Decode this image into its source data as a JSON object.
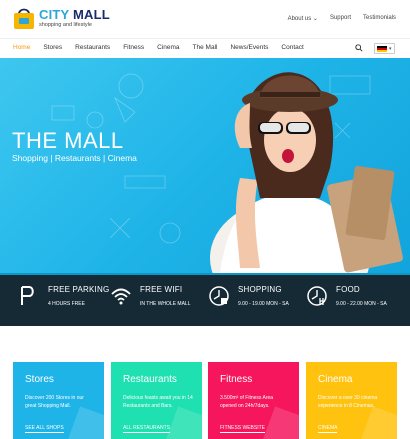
{
  "brand": {
    "title_city": "CITY",
    "title_mall": "MALL",
    "subtitle": "shopping and lifestyle"
  },
  "top_links": [
    "About us",
    "Support",
    "Testimonials"
  ],
  "nav": {
    "items": [
      "Home",
      "Stores",
      "Restaurants",
      "Fitness",
      "Cinema",
      "The Mall",
      "News/Events",
      "Contact"
    ],
    "active": "Home",
    "language": "DE"
  },
  "hero": {
    "title": "THE MALL",
    "subtitle": "Shopping | Restaurants | Cinema",
    "background": "#1fb4e8"
  },
  "features": [
    {
      "icon": "parking-icon",
      "title": "FREE PARKING",
      "sub": "4 HOURS FREE"
    },
    {
      "icon": "wifi-icon",
      "title": "FREE WIFI",
      "sub": "IN THE WHOLE MALL"
    },
    {
      "icon": "clock-shopping-icon",
      "title": "SHOPPING",
      "sub": "9.00 - 19.00 MON - SA"
    },
    {
      "icon": "clock-food-icon",
      "title": "FOOD",
      "sub": "9.00 - 22.00 MON - SA"
    }
  ],
  "cards": [
    {
      "title": "Stores",
      "text": "Discover 200 Stores in our great Shopping Mall.",
      "link": "SEE ALL SHOPS",
      "color": "#1fb4e8"
    },
    {
      "title": "Restaurants",
      "text": "Delicious feasts await you in 14 Restaurants and Bars.",
      "link": "ALL RESTAURANTS",
      "color": "#1ee0b0"
    },
    {
      "title": "Fitness",
      "text": "3.500m² of Fitness Area opened on 24h/7days.",
      "link": "FITNESS WEBSITE",
      "color": "#f5165e"
    },
    {
      "title": "Cinema",
      "text": "Discover a over 30 cinema experience in 8 Cinemas.",
      "link": "CINEMA",
      "color": "#ffc20e"
    }
  ]
}
